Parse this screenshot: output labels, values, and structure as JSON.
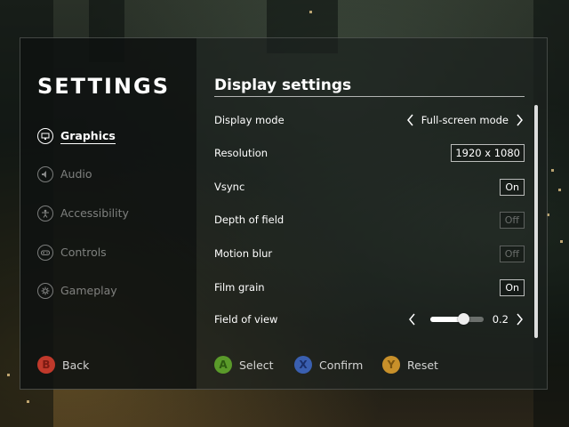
{
  "settings_title": "SETTINGS",
  "nav": [
    {
      "label": "Graphics",
      "icon": "monitor-icon",
      "active": true
    },
    {
      "label": "Audio",
      "icon": "speaker-icon",
      "active": false
    },
    {
      "label": "Accessibility",
      "icon": "person-icon",
      "active": false
    },
    {
      "label": "Controls",
      "icon": "gamepad-icon",
      "active": false
    },
    {
      "label": "Gameplay",
      "icon": "gear-icon",
      "active": false
    }
  ],
  "section_title": "Display settings",
  "rows": {
    "display_mode": {
      "label": "Display mode",
      "value": "Full-screen mode"
    },
    "resolution": {
      "label": "Resolution",
      "value": "1920 x 1080"
    },
    "vsync": {
      "label": "Vsync",
      "value": "On"
    },
    "depth_of_field": {
      "label": "Depth of field",
      "value": "Off"
    },
    "motion_blur": {
      "label": "Motion blur",
      "value": "Off"
    },
    "film_grain": {
      "label": "Film grain",
      "value": "On"
    },
    "field_of_view": {
      "label": "Field of view",
      "value": "0.2",
      "slider_fraction": 0.62
    }
  },
  "footer": {
    "back": {
      "glyph": "B",
      "label": "Back",
      "color": "#c0392b"
    },
    "select": {
      "glyph": "A",
      "label": "Select",
      "color": "#5a9a2a"
    },
    "confirm": {
      "glyph": "X",
      "label": "Confirm",
      "color": "#3a5fb0"
    },
    "reset": {
      "glyph": "Y",
      "label": "Reset",
      "color": "#c8902a"
    }
  }
}
